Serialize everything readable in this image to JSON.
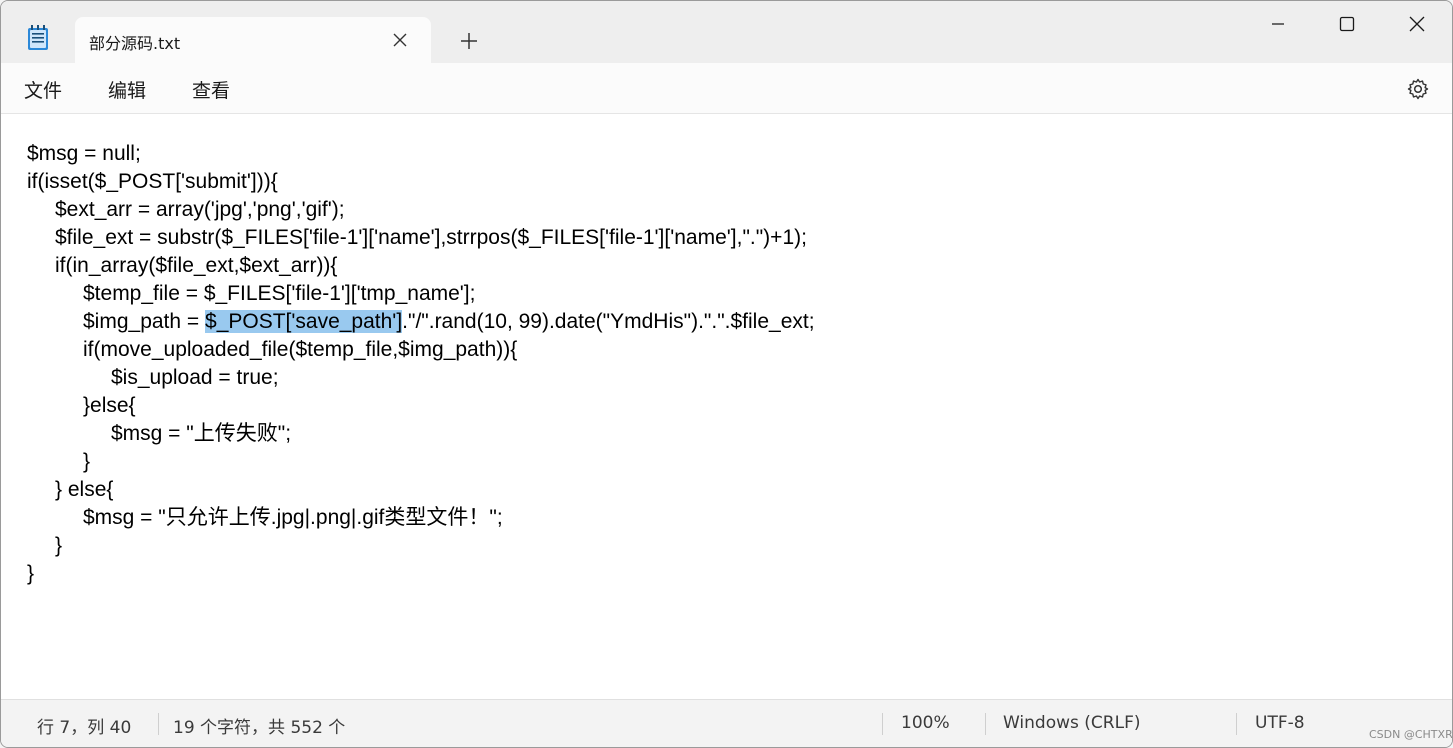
{
  "tab": {
    "title": "部分源码.txt"
  },
  "window_controls": [
    "minimize-icon",
    "maximize-icon",
    "close-icon"
  ],
  "menu": [
    "文件",
    "编辑",
    "查看"
  ],
  "editor": {
    "lines": [
      {
        "indent": 0,
        "pre": "$msg = null;",
        "sel": "",
        "post": ""
      },
      {
        "indent": 0,
        "pre": "if(isset($_POST['submit'])){",
        "sel": "",
        "post": ""
      },
      {
        "indent": 1,
        "pre": "$ext_arr = array('jpg','png','gif');",
        "sel": "",
        "post": ""
      },
      {
        "indent": 1,
        "pre": "$file_ext = substr($_FILES['file-1']['name'],strrpos($_FILES['file-1']['name'],\".\")+1);",
        "sel": "",
        "post": ""
      },
      {
        "indent": 1,
        "pre": "if(in_array($file_ext,$ext_arr)){",
        "sel": "",
        "post": ""
      },
      {
        "indent": 2,
        "pre": "$temp_file = $_FILES['file-1']['tmp_name'];",
        "sel": "",
        "post": ""
      },
      {
        "indent": 2,
        "pre": "$img_path = ",
        "sel": "$_POST['save_path']",
        "post": ".\"/\".rand(10, 99).date(\"YmdHis\").\".\".$file_ext;"
      },
      {
        "indent": 2,
        "pre": "if(move_uploaded_file($temp_file,$img_path)){",
        "sel": "",
        "post": ""
      },
      {
        "indent": 3,
        "pre": "$is_upload = true;",
        "sel": "",
        "post": ""
      },
      {
        "indent": 2,
        "pre": "}else{",
        "sel": "",
        "post": ""
      },
      {
        "indent": 3,
        "pre": "$msg = \"上传失败\";",
        "sel": "",
        "post": ""
      },
      {
        "indent": 2,
        "pre": "}",
        "sel": "",
        "post": ""
      },
      {
        "indent": 1,
        "pre": "} else{",
        "sel": "",
        "post": ""
      },
      {
        "indent": 2,
        "pre": "$msg = \"只允许上传.jpg|.png|.gif类型文件！\";",
        "sel": "",
        "post": ""
      },
      {
        "indent": 1,
        "pre": "}",
        "sel": "",
        "post": ""
      },
      {
        "indent": 0,
        "pre": "}",
        "sel": "",
        "post": ""
      }
    ]
  },
  "status": {
    "position": "行 7，列 40",
    "selection": "19 个字符，共 552 个",
    "zoom": "100%",
    "line_ending": "Windows (CRLF)",
    "encoding": "UTF-8"
  },
  "watermark": "CSDN @CHTXRT",
  "colors": {
    "selection": "#99c9ef",
    "editor_bg": "#ffffff",
    "chrome_bg": "#f3f3f3"
  }
}
